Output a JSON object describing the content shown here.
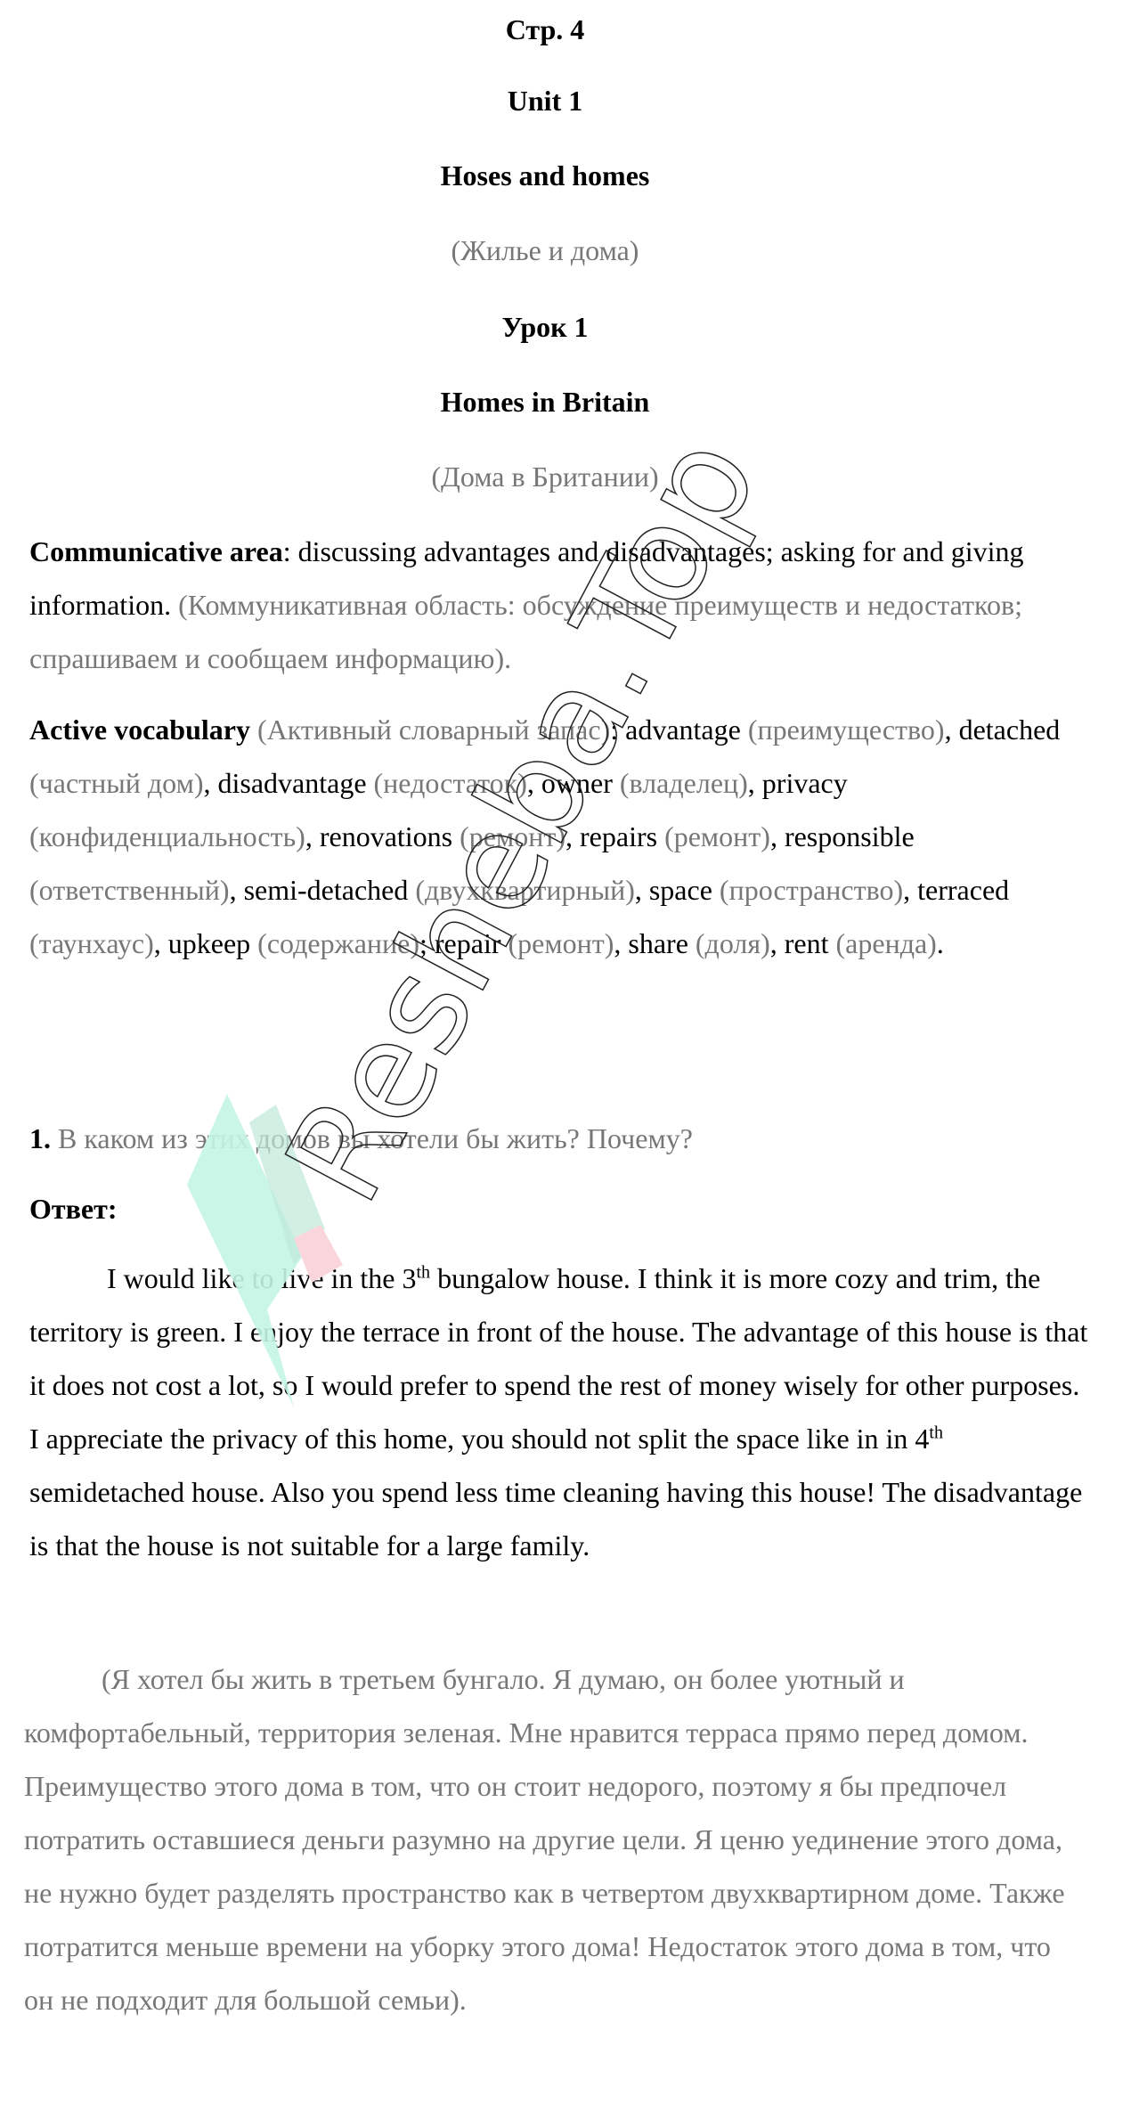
{
  "header": {
    "page": "Стр. 4",
    "unit": "Unit 1",
    "unit_title": "Hoses and homes",
    "unit_title_ru": "(Жилье и дома)",
    "lesson": "Урок 1",
    "lesson_title": "Homes in Britain",
    "lesson_title_ru": "(Дома в Британии)"
  },
  "communicative": [
    {
      "t": "Communicative area",
      "s": "b"
    },
    {
      "t": ": discussing advantages and disadvantages; asking for and giving information. ",
      "s": ""
    },
    {
      "t": "(Коммуникативная область: обсуждение преимуществ и недостатков; спрашиваем и сообщаем информацию).",
      "s": "g"
    }
  ],
  "vocabulary": [
    {
      "t": "Active vocabulary",
      "s": "b"
    },
    {
      "t": " (Активный словарный запас)",
      "s": "g"
    },
    {
      "t": ": advantage ",
      "s": ""
    },
    {
      "t": "(преимущество)",
      "s": "g"
    },
    {
      "t": ", detached ",
      "s": ""
    },
    {
      "t": "(частный дом)",
      "s": "g"
    },
    {
      "t": ", disadvantage ",
      "s": ""
    },
    {
      "t": "(недостаток)",
      "s": "g"
    },
    {
      "t": ", owner ",
      "s": ""
    },
    {
      "t": "(владелец)",
      "s": "g"
    },
    {
      "t": ", privacy ",
      "s": ""
    },
    {
      "t": "(конфиденциальность)",
      "s": "g"
    },
    {
      "t": ", renovations ",
      "s": ""
    },
    {
      "t": "(ремонт)",
      "s": "g"
    },
    {
      "t": ", repairs ",
      "s": ""
    },
    {
      "t": "(ремонт)",
      "s": "g"
    },
    {
      "t": ", responsible ",
      "s": ""
    },
    {
      "t": "(ответственный)",
      "s": "g"
    },
    {
      "t": ", semi-detached ",
      "s": ""
    },
    {
      "t": "(двухквартирный)",
      "s": "g"
    },
    {
      "t": ", space ",
      "s": ""
    },
    {
      "t": "(пространство)",
      "s": "g"
    },
    {
      "t": ", terraced ",
      "s": ""
    },
    {
      "t": "(таунхаус)",
      "s": "g"
    },
    {
      "t": ", upkeep ",
      "s": ""
    },
    {
      "t": "(содержание)",
      "s": "g"
    },
    {
      "t": "; repair ",
      "s": ""
    },
    {
      "t": "(ремонт)",
      "s": "g"
    },
    {
      "t": ", share ",
      "s": ""
    },
    {
      "t": "(доля)",
      "s": "g"
    },
    {
      "t": ", rent ",
      "s": ""
    },
    {
      "t": "(аренда)",
      "s": "g"
    },
    {
      "t": ".",
      "s": ""
    }
  ],
  "task": {
    "number": "1.",
    "question": " В каком из этих домов вы хотели бы жить? Почему?"
  },
  "answer_label": "Ответ:",
  "answer_en": [
    {
      "t": "I would like to live in the 3",
      "s": ""
    },
    {
      "t": "th",
      "s": "sup"
    },
    {
      "t": " bungalow house. I think it is more cozy and trim, the territory is green. I enjoy the terrace in front of the house. The advantage of this house is that it does not cost a lot, so I would prefer to spend the rest of money wisely for other purposes. I appreciate the privacy of this home, you should not split the space like in in 4",
      "s": ""
    },
    {
      "t": "th",
      "s": "sup"
    },
    {
      "t": " semidetached house. Also you spend less time cleaning having this house! The disadvantage is that the house is not suitable for a large family.",
      "s": ""
    }
  ],
  "answer_ru": "(Я хотел бы жить в третьем бунгало. Я думаю, он более уютный и комфортабельный, территория зеленая. Мне нравится терраса прямо перед домом. Преимущество этого дома в том, что он стоит недорого, поэтому я бы предпочел потратить оставшиеся деньги разумно на другие цели. Я ценю уединение этого дома, не нужно будет разделять пространство как в четвертом двухквартирном доме. Также потратится меньше времени на уборку этого дома! Недостаток этого дома в том, что он не подходит для большой семьи).",
  "watermark": {
    "text": "Resheba.Top",
    "colors": {
      "green": "#c4f5e4",
      "pink": "#fbd5dc"
    }
  }
}
